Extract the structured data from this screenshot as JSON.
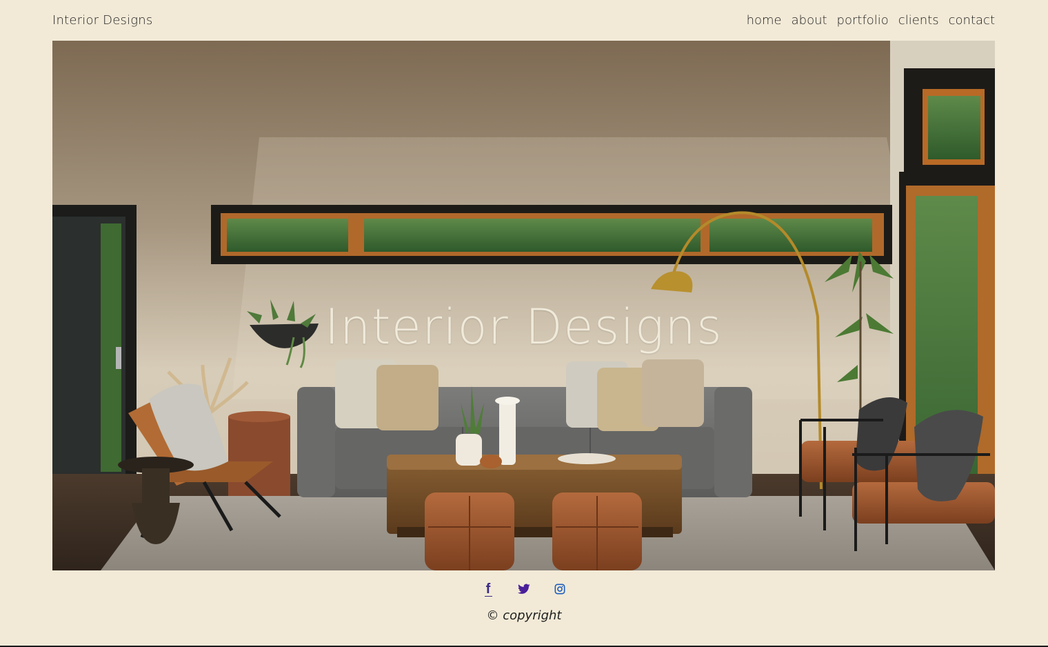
{
  "header": {
    "brand": "Interior Designs",
    "nav": [
      "home",
      "about",
      "portfolio",
      "clients",
      "contact"
    ]
  },
  "hero": {
    "title": "Interior Designs"
  },
  "social": {
    "icons": [
      "facebook-icon",
      "twitter-icon",
      "instagram-icon"
    ],
    "colors": {
      "facebook": "#3b2a84",
      "twitter": "#4a1f9a",
      "instagram": "#1f5dbb"
    }
  },
  "footer": {
    "copyright": "© copyright"
  },
  "colors": {
    "page_background": "#f2ead7",
    "text": "#1f1f1f"
  }
}
